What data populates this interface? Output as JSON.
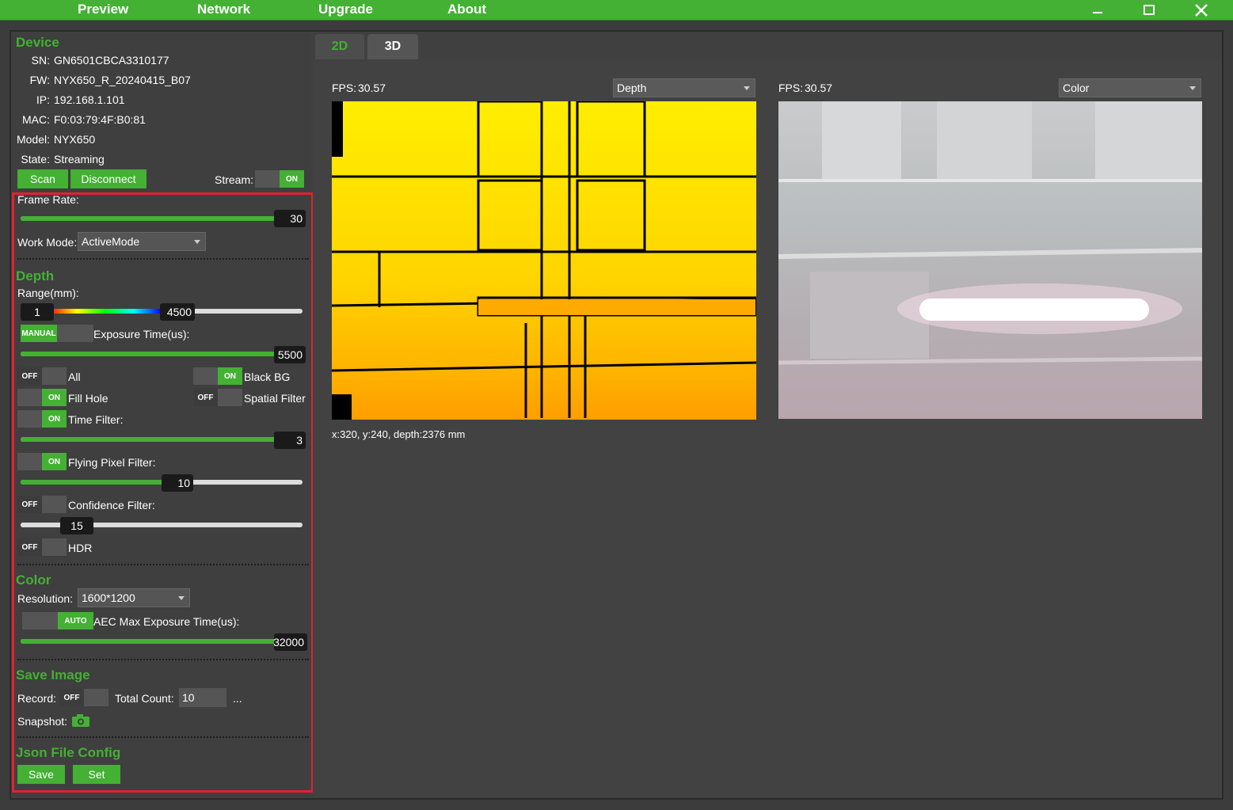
{
  "menu": {
    "preview": "Preview",
    "network": "Network",
    "upgrade": "Upgrade",
    "about": "About"
  },
  "window_buttons": [
    "minimize-icon",
    "maximize-icon",
    "close-icon"
  ],
  "device": {
    "title": "Device",
    "sn_label": "SN:",
    "sn": "GN6501CBCA3310177",
    "fw_label": "FW:",
    "fw": "NYX650_R_20240415_B07",
    "ip_label": "IP:",
    "ip": "192.168.1.101",
    "mac_label": "MAC:",
    "mac": "F0:03:79:4F:B0:81",
    "model_label": "Model:",
    "model": "NYX650",
    "state_label": "State:",
    "state": "Streaming",
    "scan": "Scan",
    "disconnect": "Disconnect",
    "stream_label": "Stream:",
    "stream_toggle": "ON"
  },
  "settings": {
    "frame_rate_label": "Frame Rate:",
    "frame_rate": "30",
    "frame_rate_fraction": 0.99,
    "work_mode_label": "Work Mode:",
    "work_mode": "ActiveMode"
  },
  "depth": {
    "title": "Depth",
    "range_label": "Range(mm):",
    "range_min": "1",
    "range_max": "4500",
    "exposure_toggle": "MANUAL",
    "exposure_label": "Exposure Time(us):",
    "exposure": "5500",
    "exposure_fraction": 0.99,
    "all_toggle": "OFF",
    "all_label": "All",
    "blackbg_toggle": "ON",
    "blackbg_label": "Black BG",
    "fillhole_toggle": "ON",
    "fillhole_label": "Fill Hole",
    "spatial_toggle": "OFF",
    "spatial_label": "Spatial Filter",
    "time_toggle": "ON",
    "time_label": "Time Filter:",
    "time_value": "3",
    "time_fraction": 0.99,
    "flying_toggle": "ON",
    "flying_label": "Flying Pixel Filter:",
    "flying_value": "10",
    "flying_fraction": 0.6,
    "confidence_toggle": "OFF",
    "confidence_label": "Confidence Filter:",
    "confidence_value": "15",
    "confidence_fraction": 0.15,
    "hdr_toggle": "OFF",
    "hdr_label": "HDR"
  },
  "color": {
    "title": "Color",
    "resolution_label": "Resolution:",
    "resolution": "1600*1200",
    "aec_toggle": "AUTO",
    "aec_label": "AEC Max Exposure Time(us):",
    "aec_value": "32000",
    "aec_fraction": 0.99
  },
  "save_image": {
    "title": "Save Image",
    "record_label": "Record:",
    "record_toggle": "OFF",
    "total_label": "Total Count:",
    "total_value": "10",
    "ellipsis": "...",
    "snapshot_label": "Snapshot:"
  },
  "json_config": {
    "title": "Json File Config",
    "save": "Save",
    "set": "Set"
  },
  "tabs": {
    "tab2d": "2D",
    "tab3d": "3D"
  },
  "view_left": {
    "fps_label": "FPS:",
    "fps": "30.57",
    "mode": "Depth",
    "readout": "x:320, y:240, depth:2376 mm"
  },
  "view_right": {
    "fps_label": "FPS:",
    "fps": "30.57",
    "mode": "Color"
  },
  "colors": {
    "accent": "#44b034",
    "highlight": "#e3212e",
    "background": "#3c3c3c"
  }
}
